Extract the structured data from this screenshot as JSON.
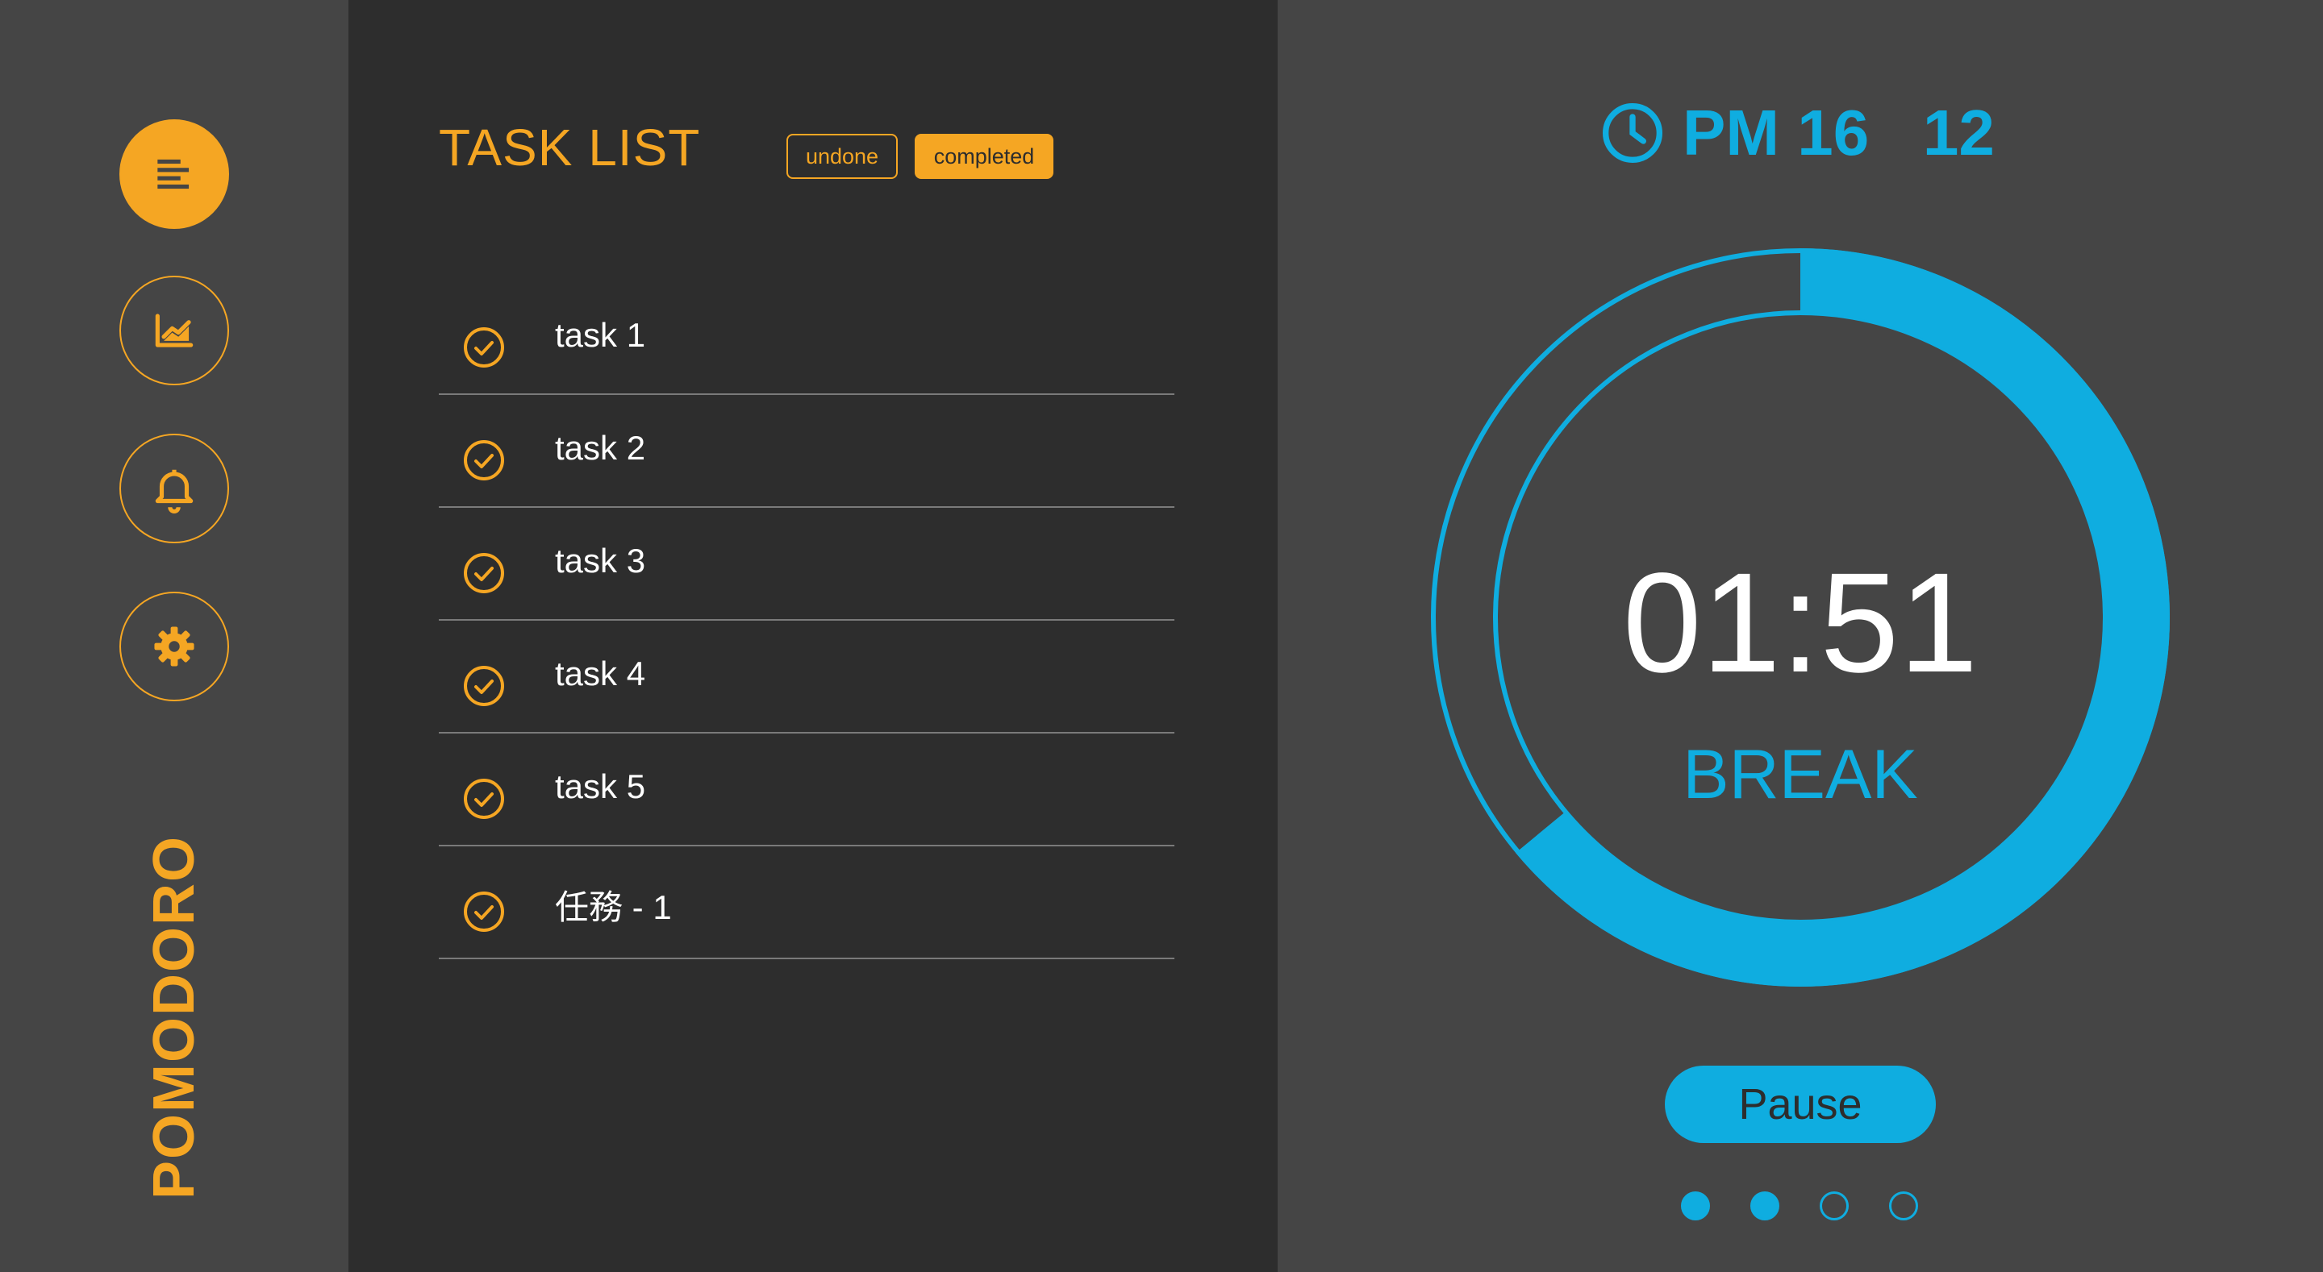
{
  "brand": "POMODORO",
  "colors": {
    "accent": "#f5a623",
    "timer": "#0fade0",
    "panel_dark": "#2d2d2d",
    "panel_mid": "#454545"
  },
  "sidebar": {
    "items": [
      {
        "name": "list",
        "icon": "align-left-icon",
        "active": true
      },
      {
        "name": "analytics",
        "icon": "chart-icon",
        "active": false
      },
      {
        "name": "notifications",
        "icon": "bell-icon",
        "active": false
      },
      {
        "name": "settings",
        "icon": "gear-icon",
        "active": false
      }
    ]
  },
  "task_panel": {
    "title": "TASK LIST",
    "filters": {
      "undone": "undone",
      "completed": "completed",
      "selected": "completed"
    },
    "tasks": [
      {
        "label": "task 1",
        "done": true
      },
      {
        "label": "task 2",
        "done": true
      },
      {
        "label": "task 3",
        "done": true
      },
      {
        "label": "task 4",
        "done": true
      },
      {
        "label": "task 5",
        "done": true
      },
      {
        "label": "任務 - 1",
        "done": true
      }
    ]
  },
  "timer": {
    "clock_icon": "clock-icon",
    "clock_text": "PM 16   12",
    "time": "01:51",
    "mode": "BREAK",
    "progress_fraction": 0.64,
    "pause_label": "Pause",
    "session_dots": [
      true,
      true,
      false,
      false
    ]
  }
}
